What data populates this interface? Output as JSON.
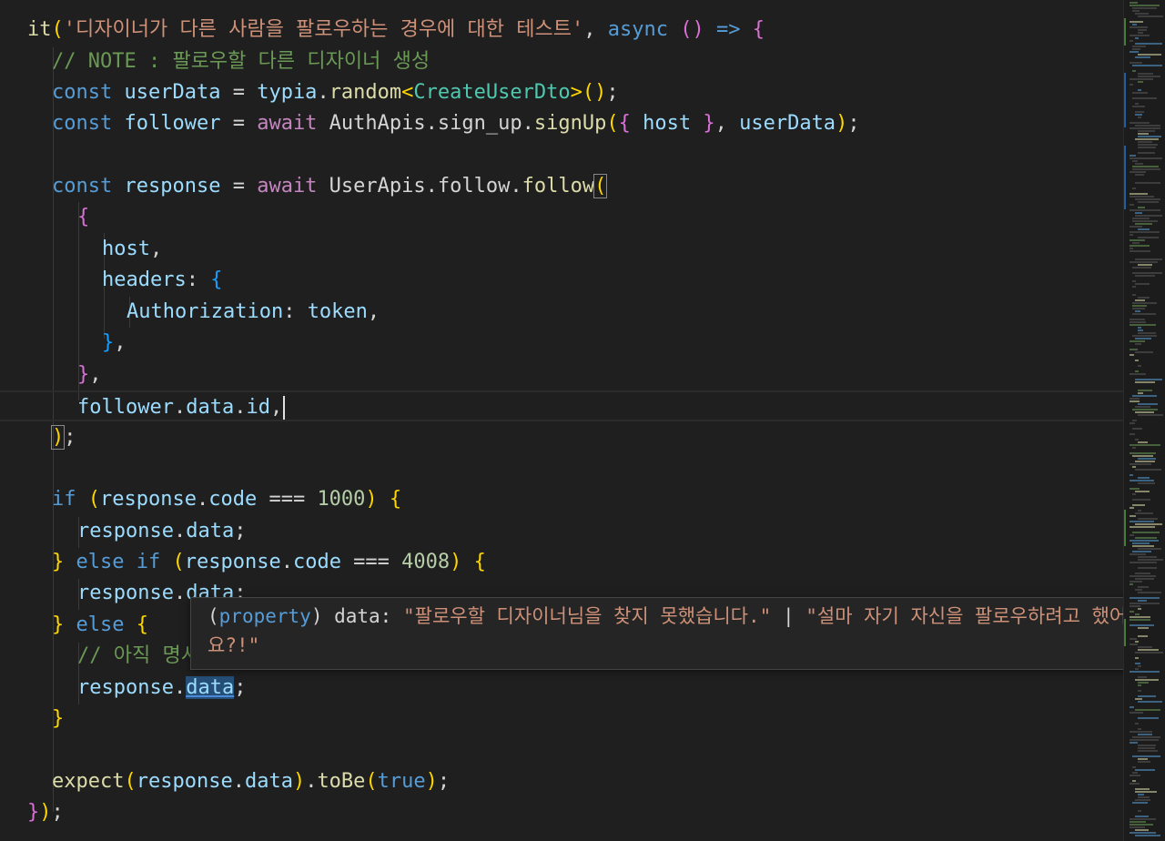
{
  "code": {
    "l1": {
      "it": "it",
      "open": "(",
      "desc": "'디자이너가 다른 사람을 팔로우하는 경우에 대한 테스트'",
      "comma": ", ",
      "async": "async",
      "arrow_l": " (",
      "arrow_r": ")",
      "arrow": " => ",
      "brace": "{"
    },
    "l2": {
      "comment": "// NOTE : 팔로우할 다른 디자이너 생성"
    },
    "l3": {
      "const": "const",
      "name": " userData",
      "eq": " = ",
      "obj": "typia",
      "dot": ".",
      "fn": "random",
      "lt": "<",
      "type": "CreateUserDto",
      "gt": ">",
      "call": "()",
      "semi": ";"
    },
    "l4": {
      "const": "const",
      "name": " follower",
      "eq": " = ",
      "await": "await",
      "obj": " AuthApis",
      "dot1": ".",
      "prop": "sign_up",
      "dot2": ".",
      "fn": "signUp",
      "open": "(",
      "ob": "{",
      "host": " host ",
      "cb": "}",
      "comma": ", ",
      "arg": "userData",
      "close": ")",
      "semi": ";"
    },
    "l6": {
      "const": "const",
      "name": " response",
      "eq": " = ",
      "await": "await",
      "obj": " UserApis",
      "dot1": ".",
      "prop": "follow",
      "dot2": ".",
      "fn": "follow",
      "open": "("
    },
    "l7": {
      "brace": "{"
    },
    "l8": {
      "host": "host",
      "comma": ","
    },
    "l9": {
      "key": "headers",
      "colon": ": ",
      "brace": "{"
    },
    "l10": {
      "key": "Authorization",
      "colon": ": ",
      "val": "token",
      "comma": ","
    },
    "l11": {
      "brace": "}",
      "comma": ","
    },
    "l12": {
      "brace": "}",
      "comma": ","
    },
    "l13": {
      "obj": "follower",
      "dot1": ".",
      "p1": "data",
      "dot2": ".",
      "p2": "id",
      "comma": ","
    },
    "l14": {
      "close": ")",
      "semi": ";"
    },
    "l16": {
      "if": "if",
      "open": " (",
      "obj": "response",
      "dot": ".",
      "prop": "code",
      "op": " === ",
      "num": "1000",
      "close": ")",
      "brace": " {"
    },
    "l17": {
      "obj": "response",
      "dot": ".",
      "prop": "data",
      "semi": ";"
    },
    "l18": {
      "cb": "}",
      "else": " else",
      "if": " if",
      "open": " (",
      "obj": "response",
      "dot": ".",
      "prop": "code",
      "op": " === ",
      "num": "4008",
      "close": ")",
      "brace": " {"
    },
    "l19": {
      "obj": "response",
      "dot": ".",
      "prop": "data",
      "semi": ";"
    },
    "l20": {
      "cb": "}",
      "else": " else",
      "brace": " {"
    },
    "l21": {
      "comment": "// 아직 명시"
    },
    "l22": {
      "obj": "response",
      "dot": ".",
      "prop": "data",
      "semi": ";"
    },
    "l23": {
      "cb": "}"
    },
    "l25": {
      "fn": "expect",
      "open": "(",
      "obj": "response",
      "dot": ".",
      "prop": "data",
      "close": ")",
      "dot2": ".",
      "fn2": "toBe",
      "open2": "(",
      "val": "true",
      "close2": ")",
      "semi": ";"
    },
    "l26": {
      "cb": "}",
      "close": ")",
      "semi": ";"
    }
  },
  "hover": {
    "open": "(",
    "kind": "property",
    "close": ")",
    "name": " data: ",
    "type1": "\"팔로우할 디자이너님을 찾지 못했습니다.\"",
    "pipe": " | ",
    "type2": "\"설마 자기 자신을 팔로우하려고 했어요?!\""
  }
}
